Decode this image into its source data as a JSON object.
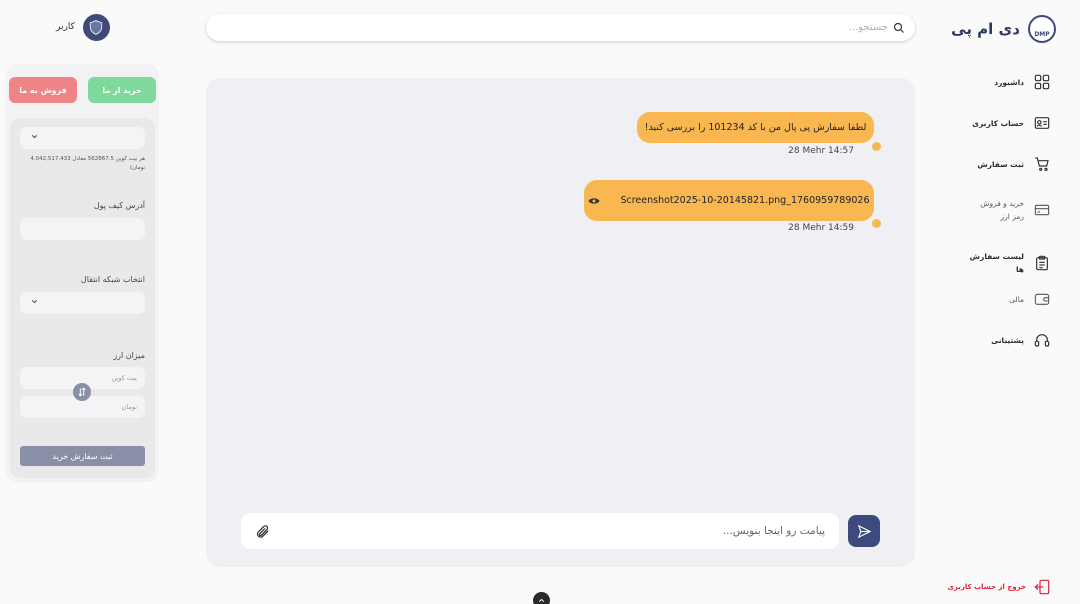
{
  "brand": {
    "title": "دی ام پی",
    "logo_text": "DMP"
  },
  "search": {
    "placeholder": "جستجو..."
  },
  "user": {
    "label": "کاربر"
  },
  "nav": {
    "items": [
      {
        "label": "داشبورد",
        "icon": "grid-icon"
      },
      {
        "label": "حساب کاربری",
        "icon": "id-card-icon"
      },
      {
        "label": "ثبت سفارش",
        "icon": "cart-icon"
      },
      {
        "label": "خرید و فروش رمز ارز",
        "icon": "card-icon"
      },
      {
        "label": "لیست سفارش ها",
        "icon": "clipboard-icon"
      },
      {
        "label": "مالی",
        "icon": "wallet-icon"
      },
      {
        "label": "پشتیبانی",
        "icon": "headset-icon"
      }
    ],
    "logout": "خروج از حساب کاربری"
  },
  "chat": {
    "messages": [
      {
        "text": "لطفا سفارش پی پال من با کد 101234 را بررسی کنید!",
        "time": "28 Mehr 14:57"
      },
      {
        "text": "Screenshot2025-10-20145821.png_1760959789026",
        "time": "28 Mehr 14:59",
        "attachment_icon": "eye-icon"
      }
    ],
    "composer_placeholder": "پیامت رو اینجا بنویس..."
  },
  "trade": {
    "buy_label": "خرید از ما",
    "sell_label": "فروش به ما",
    "rate_note": "هر بیت کوین 562867.5 معادل 4,042,517,433 تومان)",
    "wallet_label": "آدرس کیف پول",
    "network_label": "انتخاب شبکه انتقال",
    "amount_label": "میزان ارز",
    "crypto_placeholder": "بیت کوین",
    "toman_placeholder": "تومان",
    "submit_label": "ثبت سفارش خرید"
  },
  "colors": {
    "brand": "#3d4a7d",
    "bubble": "#f9b751",
    "buy": "#7ed99b",
    "sell": "#ef8486",
    "logout": "#e0223a"
  }
}
